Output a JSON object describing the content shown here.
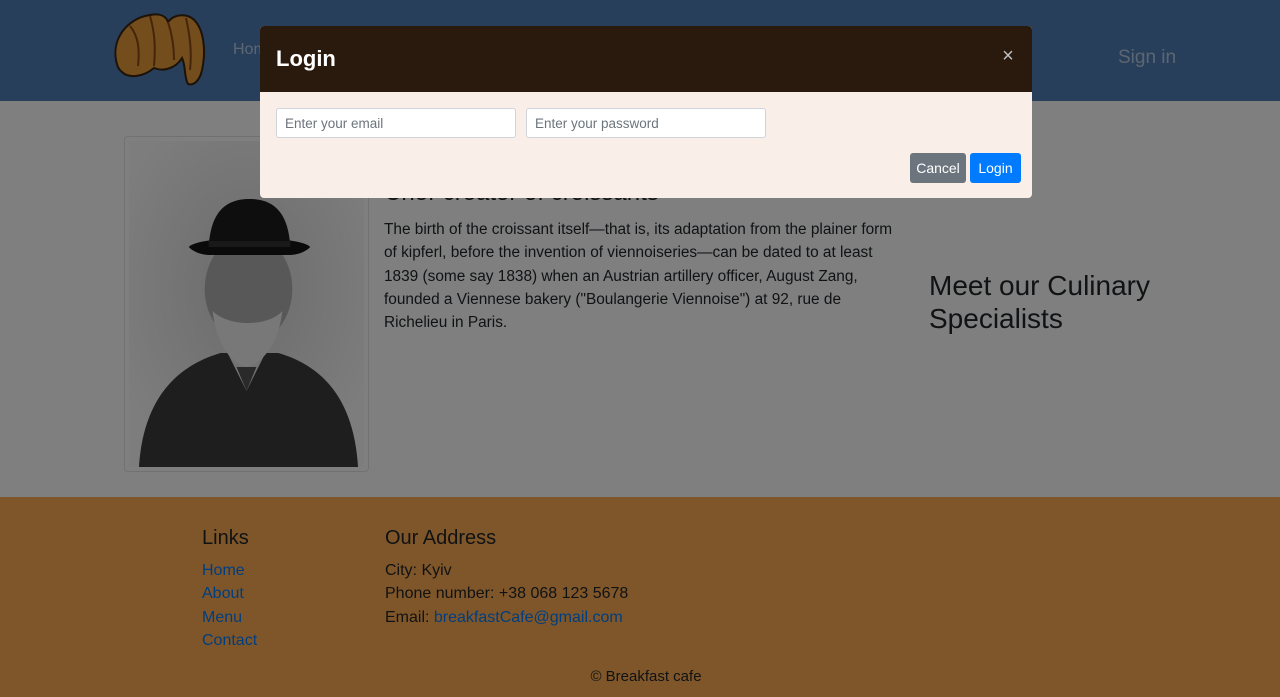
{
  "nav": {
    "home_label": "Home",
    "signin_label": "Sign in"
  },
  "chef": {
    "title": "Chef-creator of croissants",
    "text": "The birth of the croissant itself—that is, its adaptation from the plainer form of kipferl, before the invention of viennoiseries—can be dated to at least 1839 (some say 1838) when an Austrian artillery officer, August Zang, founded a Viennese bakery (\"Boulangerie Viennoise\") at 92, rue de Richelieu in Paris."
  },
  "meet_title": "Meet our Culinary Specialists",
  "footer": {
    "links_heading": "Links",
    "links": [
      "Home",
      "About",
      "Menu",
      "Contact"
    ],
    "address_heading": "Our Address",
    "city": "City: Kyiv",
    "phone": "Phone number: +38 068 123 5678",
    "email_label": "Email: ",
    "email": "breakfastCafe@gmail.com",
    "copyright": "© Breakfast cafe"
  },
  "modal": {
    "title": "Login",
    "email_placeholder": "Enter your email",
    "password_placeholder": "Enter your password",
    "cancel_label": "Cancel",
    "login_label": "Login"
  },
  "colors": {
    "navbar": "#4f7fb7",
    "footer": "#ffad53",
    "modal_header": "#2a1a0e",
    "modal_body": "#faeee8",
    "primary": "#007bff",
    "secondary": "#6c757d"
  },
  "icons": {
    "logo": "croissant-logo",
    "close": "close-icon"
  }
}
